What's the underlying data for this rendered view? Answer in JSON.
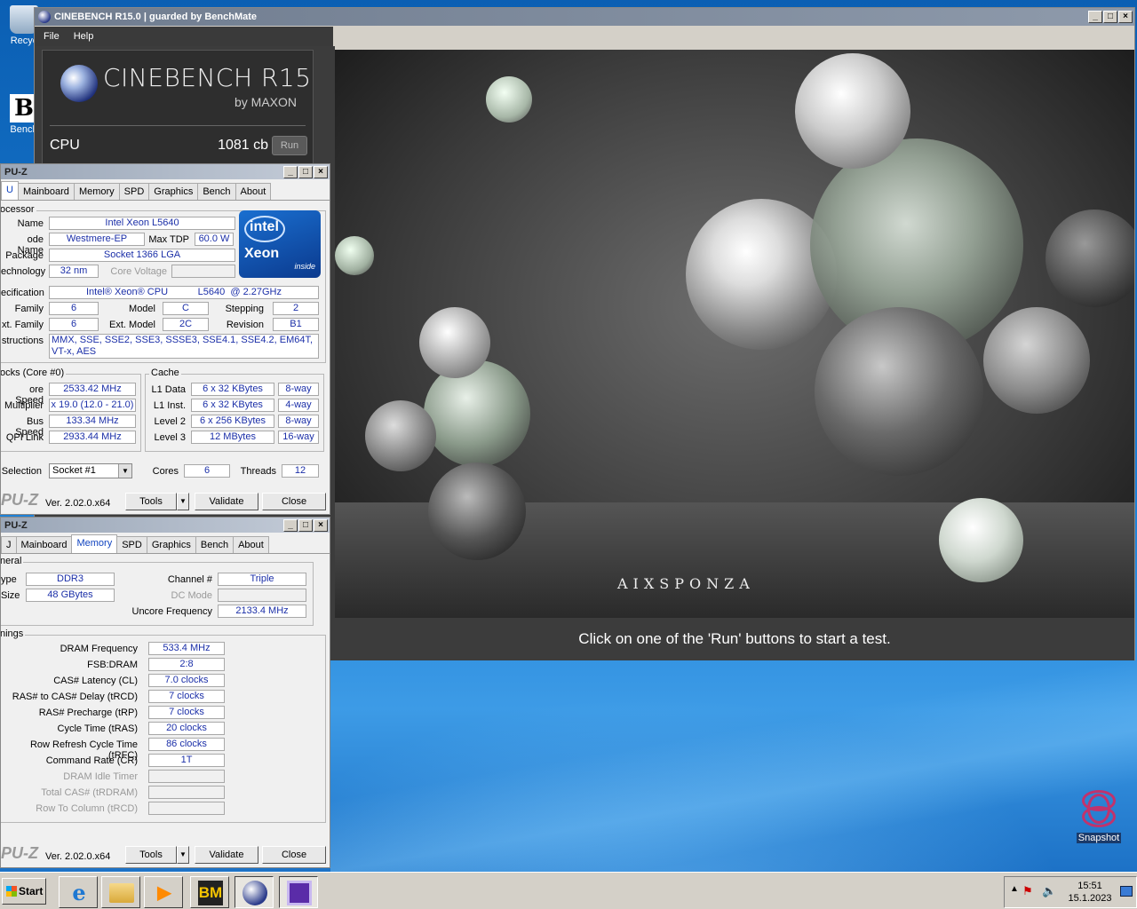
{
  "desktop": {
    "recycle_label": "Recyc",
    "bench_label": "Bench",
    "snapshot_label": "Snapshot"
  },
  "cinebench": {
    "title": "CINEBENCH R15.0 | guarded by BenchMate",
    "menu": [
      "File",
      "Help"
    ],
    "logo_title": "CINEBENCH R15",
    "logo_by": "by MAXON",
    "cpu_label": "CPU",
    "cpu_score": "1081 cb",
    "run_label": "Run",
    "render_logo": "AIXSPONZA",
    "status": "Click on one of the 'Run' buttons to start a test."
  },
  "cpuz1": {
    "title": "PU-Z",
    "tabs": [
      "U",
      "Mainboard",
      "Memory",
      "SPD",
      "Graphics",
      "Bench",
      "About"
    ],
    "processor_group": "ocessor",
    "name_label": "Name",
    "name": "Intel Xeon L5640",
    "codename_label": "ode Name",
    "codename": "Westmere-EP",
    "maxtdp_label": "Max TDP",
    "maxtdp": "60.0 W",
    "package_label": "Package",
    "package": "Socket 1366 LGA",
    "technology_label": "echnology",
    "technology": "32 nm",
    "corevoltage_label": "Core Voltage",
    "spec_label": "ecification",
    "spec": "Intel® Xeon® CPU           L5640  @ 2.27GHz",
    "family_label": "Family",
    "family": "6",
    "model_label": "Model",
    "model": "C",
    "stepping_label": "Stepping",
    "stepping": "2",
    "extfamily_label": "xt. Family",
    "extfamily": "6",
    "extmodel_label": "Ext. Model",
    "extmodel": "2C",
    "revision_label": "Revision",
    "revision": "B1",
    "instructions_label": "structions",
    "instructions": "MMX, SSE, SSE2, SSE3, SSSE3, SSE4.1, SSE4.2, EM64T, VT-x, AES",
    "intel_brand": "intel",
    "intel_product": "Xeon",
    "intel_inside": "inside",
    "clocks_group": "ocks (Core #0)",
    "corespeed_label": "ore Speed",
    "corespeed": "2533.42 MHz",
    "multiplier_label": "Multiplier",
    "multiplier": "x 19.0 (12.0 - 21.0)",
    "busspeed_label": "Bus Speed",
    "busspeed": "133.34 MHz",
    "qpi_label": "QPI Link",
    "qpi": "2933.44 MHz",
    "cache_group": "Cache",
    "l1d_label": "L1 Data",
    "l1d": "6 x 32 KBytes",
    "l1d_way": "8-way",
    "l1i_label": "L1 Inst.",
    "l1i": "6 x 32 KBytes",
    "l1i_way": "4-way",
    "l2_label": "Level 2",
    "l2": "6 x 256 KBytes",
    "l2_way": "8-way",
    "l3_label": "Level 3",
    "l3": "12 MBytes",
    "l3_way": "16-way",
    "selection_label": "Selection",
    "selection": "Socket #1",
    "cores_label": "Cores",
    "cores": "6",
    "threads_label": "Threads",
    "threads": "12",
    "brand": "PU-Z",
    "version": "Ver. 2.02.0.x64",
    "tools": "Tools",
    "validate": "Validate",
    "close": "Close"
  },
  "cpuz2": {
    "title": "PU-Z",
    "tabs": [
      "J",
      "Mainboard",
      "Memory",
      "SPD",
      "Graphics",
      "Bench",
      "About"
    ],
    "general_group": "neral",
    "type_label": "ype",
    "type": "DDR3",
    "size_label": "Size",
    "size": "48 GBytes",
    "channel_label": "Channel #",
    "channel": "Triple",
    "dcmode_label": "DC Mode",
    "uncore_label": "Uncore Frequency",
    "uncore": "2133.4 MHz",
    "timings_group": "nings",
    "timings": [
      {
        "label": "DRAM Frequency",
        "value": "533.4 MHz"
      },
      {
        "label": "FSB:DRAM",
        "value": "2:8"
      },
      {
        "label": "CAS# Latency (CL)",
        "value": "7.0 clocks"
      },
      {
        "label": "RAS# to CAS# Delay (tRCD)",
        "value": "7 clocks"
      },
      {
        "label": "RAS# Precharge (tRP)",
        "value": "7 clocks"
      },
      {
        "label": "Cycle Time (tRAS)",
        "value": "20 clocks"
      },
      {
        "label": "Row Refresh Cycle Time (tRFC)",
        "value": "86 clocks"
      },
      {
        "label": "Command Rate (CR)",
        "value": "1T"
      },
      {
        "label": "DRAM Idle Timer",
        "value": ""
      },
      {
        "label": "Total CAS# (tRDRAM)",
        "value": ""
      },
      {
        "label": "Row To Column (tRCD)",
        "value": ""
      }
    ],
    "brand": "PU-Z",
    "version": "Ver. 2.02.0.x64",
    "tools": "Tools",
    "validate": "Validate",
    "close": "Close"
  },
  "taskbar": {
    "start": "Start",
    "time": "15:51",
    "date": "15.1.2023",
    "bm_label": "BM"
  }
}
